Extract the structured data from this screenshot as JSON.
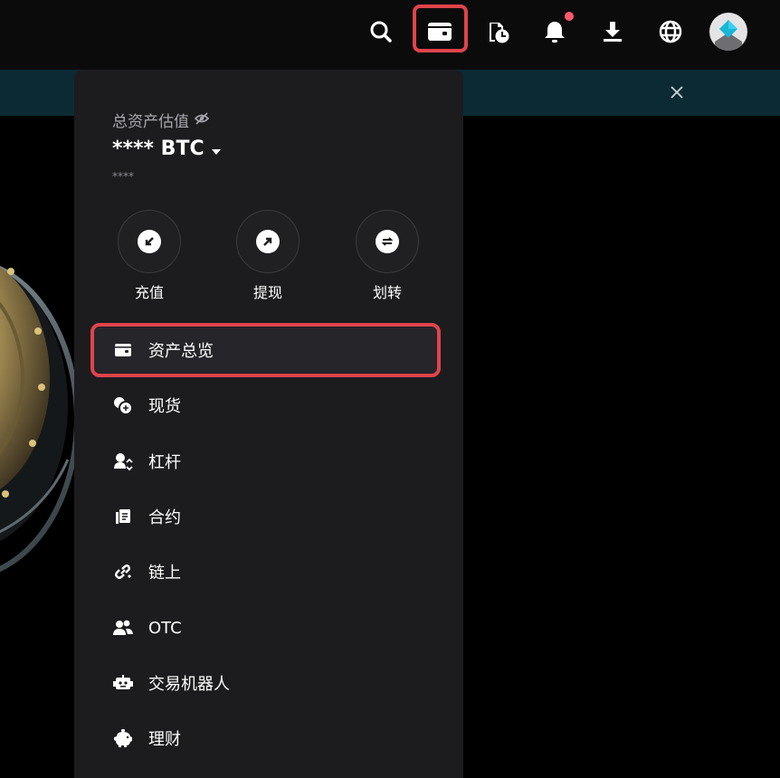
{
  "header": {
    "icons": [
      "search-icon",
      "wallet-icon",
      "order-history-icon",
      "bell-icon",
      "download-icon",
      "globe-icon"
    ],
    "has_notification": true,
    "highlight_color": "#e0444c"
  },
  "banner": {
    "bg_color": "#0c2a33"
  },
  "assets": {
    "total_label": "总资产估值",
    "total_value": "**** BTC",
    "total_sub": "****"
  },
  "actions": [
    {
      "label": "充值",
      "icon": "deposit-icon"
    },
    {
      "label": "提现",
      "icon": "withdraw-icon"
    },
    {
      "label": "划转",
      "icon": "transfer-icon"
    }
  ],
  "menu": [
    {
      "label": "资产总览",
      "icon": "wallet-icon",
      "active": true
    },
    {
      "label": "现货",
      "icon": "spot-icon"
    },
    {
      "label": "杠杆",
      "icon": "margin-icon"
    },
    {
      "label": "合约",
      "icon": "futures-icon"
    },
    {
      "label": "链上",
      "icon": "onchain-icon"
    },
    {
      "label": "OTC",
      "icon": "otc-icon"
    },
    {
      "label": "交易机器人",
      "icon": "bot-icon"
    },
    {
      "label": "理财",
      "icon": "earn-icon"
    }
  ]
}
